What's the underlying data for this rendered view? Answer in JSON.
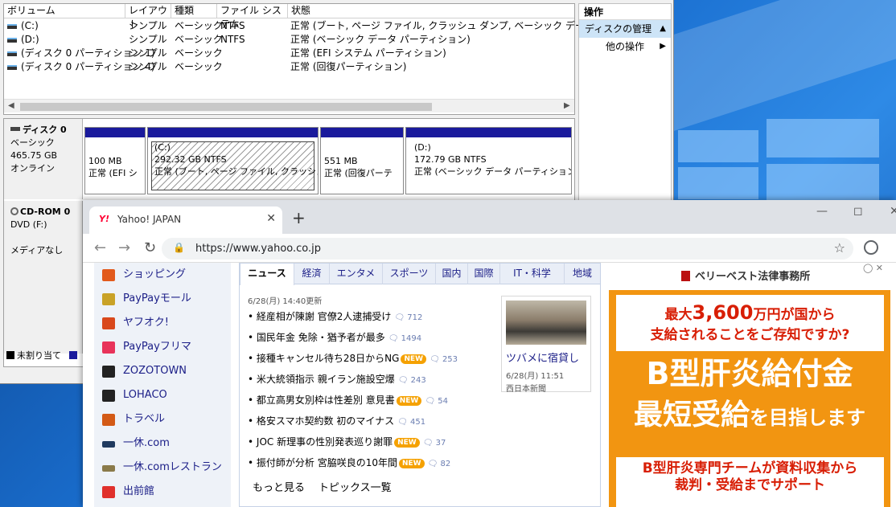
{
  "volume_list": {
    "headers": [
      "ボリューム",
      "レイアウト",
      "種類",
      "ファイル システム",
      "状態"
    ],
    "rows": [
      {
        "volume": "(C:)",
        "layout": "シンプル",
        "type": "ベーシック",
        "fs": "NTFS",
        "status": "正常 (ブート, ページ ファイル, クラッシュ ダンプ, ベーシック データ パーティション)"
      },
      {
        "volume": "(D:)",
        "layout": "シンプル",
        "type": "ベーシック",
        "fs": "NTFS",
        "status": "正常 (ベーシック データ パーティション)"
      },
      {
        "volume": "(ディスク 0 パーティション 1)",
        "layout": "シンプル",
        "type": "ベーシック",
        "fs": "",
        "status": "正常 (EFI システム パーティション)"
      },
      {
        "volume": "(ディスク 0 パーティション 4)",
        "layout": "シンプル",
        "type": "ベーシック",
        "fs": "",
        "status": "正常 (回復パーティション)"
      }
    ]
  },
  "actions": {
    "header": "操作",
    "selected": "ディスクの管理",
    "other": "他の操作"
  },
  "disk0": {
    "name": "ディスク 0",
    "kind": "ベーシック",
    "size": "465.75 GB",
    "state": "オンライン",
    "partitions": [
      {
        "line1": "100 MB",
        "line2": "正常 (EFI シ"
      },
      {
        "name": "(C:)",
        "line1": "292.32 GB NTFS",
        "line2": "正常 (ブート, ページ ファイル, クラッシュ ダン"
      },
      {
        "line1": "551 MB",
        "line2": "正常 (回復パーテ"
      },
      {
        "name": "(D:)",
        "line1": "172.79 GB NTFS",
        "line2": "正常 (ベーシック データ パーティション)"
      }
    ]
  },
  "cdrom": {
    "name": "CD-ROM 0",
    "drive": "DVD (F:)",
    "media": "メディアなし"
  },
  "legend": {
    "unallocated": "未割り当て"
  },
  "browser": {
    "tab_title": "Yahoo! JAPAN",
    "favicon": "Y!",
    "url": "https://www.yahoo.co.jp"
  },
  "services": [
    {
      "label": "ショッピング",
      "color": "#e25a1c"
    },
    {
      "label": "PayPayモール",
      "color": "#c9a227"
    },
    {
      "label": "ヤフオク!",
      "color": "#d9481c"
    },
    {
      "label": "PayPayフリマ",
      "color": "#e8335a"
    },
    {
      "label": "ZOZOTOWN",
      "color": "#222222"
    },
    {
      "label": "LOHACO",
      "color": "#222222"
    },
    {
      "label": "トラベル",
      "color": "#d35a16"
    },
    {
      "label": "一休.com",
      "color": "#1f3a5f"
    },
    {
      "label": "一休.comレストラン",
      "color": "#8a7a4a"
    },
    {
      "label": "出前館",
      "color": "#e0302c"
    }
  ],
  "news": {
    "tabs": [
      "ニュース",
      "経済",
      "エンタメ",
      "スポーツ",
      "国内",
      "国際",
      "IT・科学",
      "地域"
    ],
    "updated": "6/28(月) 14:40更新",
    "items": [
      {
        "text": "経産相が陳謝 官僚2人逮捕受け",
        "new": false,
        "comments": "712"
      },
      {
        "text": "国民年金 免除・猶予者が最多",
        "new": false,
        "comments": "1494"
      },
      {
        "text": "接種キャンセル待ち28日からNG",
        "new": true,
        "comments": "253"
      },
      {
        "text": "米大統領指示 親イラン施設空爆",
        "new": false,
        "comments": "243"
      },
      {
        "text": "都立高男女別枠は性差別 意見書",
        "new": true,
        "comments": "54"
      },
      {
        "text": "格安スマホ契約数 初のマイナス",
        "new": false,
        "comments": "451"
      },
      {
        "text": "JOC 新理事の性別発表巡り謝罪",
        "new": true,
        "comments": "37"
      },
      {
        "text": "振付師が分析 宮脇咲良の10年間",
        "new": true,
        "comments": "82"
      }
    ],
    "new_badge": "NEW",
    "more": "もっと見る",
    "topics": "トピックス一覧",
    "topic": {
      "caption": "ツバメに宿貸し",
      "date": "6/28(月) 11:51",
      "source": "西日本新聞"
    }
  },
  "ad": {
    "firm": "ベリーベスト法律事務所",
    "line1_pre": "最大",
    "line1_amount": "3,600",
    "line1_post": "万円が国から",
    "line2": "支給されることをご存知ですか?",
    "headline1": "B型肝炎給付金",
    "headline2_a": "最短受給",
    "headline2_b": "を目指します",
    "sub1": "B型肝炎専門チームが資料収集から",
    "sub2": "裁判・受給までサポート"
  }
}
